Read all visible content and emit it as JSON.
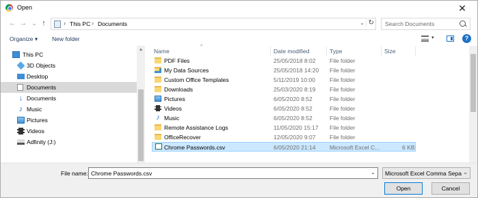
{
  "window": {
    "title": "Open",
    "close_glyph": "✕"
  },
  "nav": {
    "back_glyph": "←",
    "forward_glyph": "→",
    "recent_glyph": "⌄",
    "up_glyph": "↑",
    "breadcrumb": [
      "This PC",
      "Documents"
    ],
    "crumb_sep": "›",
    "dropdown_glyph": "⌄",
    "refresh_glyph": "↻",
    "search_placeholder": "Search Documents"
  },
  "toolbar": {
    "organize_label": "Organize ▾",
    "new_folder_label": "New folder",
    "view_dropdown_glyph": "▾",
    "help_glyph": "?"
  },
  "sidebar": {
    "scroll_up_glyph": "▲",
    "items": [
      {
        "label": "This PC",
        "icon": "computer-icon",
        "indent": 0
      },
      {
        "label": "3D Objects",
        "icon": "cube-icon",
        "indent": 1
      },
      {
        "label": "Desktop",
        "icon": "desktop-icon",
        "indent": 1
      },
      {
        "label": "Documents",
        "icon": "document-icon",
        "indent": 1,
        "selected": true
      },
      {
        "label": "Documents",
        "icon": "download-icon",
        "indent": 1
      },
      {
        "label": "Music",
        "icon": "music-icon",
        "indent": 1
      },
      {
        "label": "Pictures",
        "icon": "picture-icon",
        "indent": 1
      },
      {
        "label": "Videos",
        "icon": "video-icon",
        "indent": 1
      },
      {
        "label": "Adfinity (J:)",
        "icon": "drive-icon",
        "indent": 1
      }
    ]
  },
  "columns": {
    "name": "Name",
    "date": "Date modified",
    "type": "Type",
    "size": "Size",
    "sort_glyph": "^"
  },
  "files": [
    {
      "name": "PDF Files",
      "date": "25/05/2018 8:02",
      "type": "File folder",
      "size": "",
      "icon": "folder-icon"
    },
    {
      "name": "My Data Sources",
      "date": "25/05/2018 14:20",
      "type": "File folder",
      "size": "",
      "icon": "data-sources-icon"
    },
    {
      "name": "Custom Office Templates",
      "date": "5/11/2019 10:00",
      "type": "File folder",
      "size": "",
      "icon": "folder-icon"
    },
    {
      "name": "Downloads",
      "date": "25/03/2020 8:19",
      "type": "File folder",
      "size": "",
      "icon": "folder-icon"
    },
    {
      "name": "Pictures",
      "date": "6/05/2020 8:52",
      "type": "File folder",
      "size": "",
      "icon": "picture-icon"
    },
    {
      "name": "Videos",
      "date": "6/05/2020 8:52",
      "type": "File folder",
      "size": "",
      "icon": "video-icon"
    },
    {
      "name": "Music",
      "date": "6/05/2020 8:52",
      "type": "File folder",
      "size": "",
      "icon": "music-icon"
    },
    {
      "name": "Remote Assistance Logs",
      "date": "11/05/2020 15:17",
      "type": "File folder",
      "size": "",
      "icon": "folder-icon"
    },
    {
      "name": "OfficeRecover",
      "date": "12/05/2020 9:07",
      "type": "File folder",
      "size": "",
      "icon": "folder-icon"
    },
    {
      "name": "Chrome Passwords.csv",
      "date": "6/05/2020 21:14",
      "type": "Microsoft Excel C...",
      "size": "6 KB",
      "icon": "excel-csv-icon",
      "selected": true
    }
  ],
  "bottom": {
    "file_name_label": "File name:",
    "file_name_value": "Chrome Passwords.csv",
    "file_name_dropdown_glyph": "⌄",
    "file_type_value": "Microsoft Excel Comma Separa",
    "file_type_dropdown_glyph": "⌄",
    "open_label": "Open",
    "cancel_label": "Cancel"
  },
  "colors": {
    "selection": "#cce8ff",
    "selection_border": "#99d1ff",
    "tree_selected": "#d9d9d9",
    "accent": "#0078d7",
    "folder": "#f8d775"
  }
}
